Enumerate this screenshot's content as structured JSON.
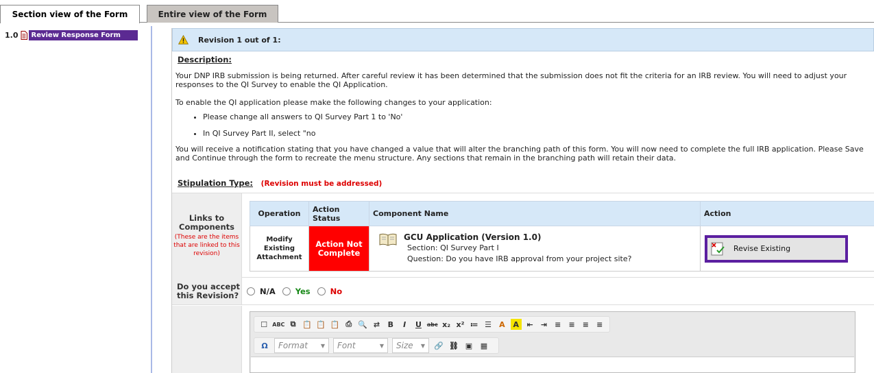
{
  "tabs": [
    {
      "label": "Section view of the Form"
    },
    {
      "label": "Entire view of the Form"
    }
  ],
  "tree": {
    "number": "1.0",
    "item_label": "Review Response Form"
  },
  "revision": {
    "header": "Revision 1 out of 1:",
    "description_title": "Description:",
    "paragraph1": "Your DNP IRB  submission is being returned. After careful review it has been determined that the submission does not fit the criteria for an IRB review. You will need to adjust your responses to the QI Survey to enable the QI Application.",
    "paragraph2": "To enable the QI application please make the following changes to your application:",
    "bullets": [
      "Please change all answers to QI Survey Part 1 to 'No'",
      "In QI Survey Part II, select \"no"
    ],
    "paragraph3": "You will receive a notification stating that you have changed a value that will alter the branching path of this form. You will now need to complete the full IRB application. Please Save and Continue through the form to recreate the menu structure. Any sections that remain in the branching path will retain their data.",
    "stipulation_label": "Stipulation Type:",
    "stipulation_value": "(Revision must be addressed)"
  },
  "links": {
    "label": "Links to Components",
    "sublabel": "(These are the items that are linked to this revision)",
    "headers": [
      "Operation",
      "Action Status",
      "Component Name",
      "Action"
    ],
    "row": {
      "operation": "Modify Existing Attachment",
      "status": "Action Not Complete",
      "component_title": "GCU Application   (Version 1.0)",
      "section": "Section:   QI Survey Part I",
      "question": "Question: Do you have IRB approval from your project site?",
      "action_label": "Revise Existing"
    }
  },
  "accept": {
    "label": "Do you accept this Revision?",
    "options": [
      "N/A",
      "Yes",
      "No"
    ]
  },
  "editor": {
    "format_label": "Format",
    "font_label": "Font",
    "size_label": "Size"
  },
  "colors": {
    "accent": "#5b2a92",
    "header_bg": "#d6e8f8",
    "status_red": "#ff0000"
  }
}
